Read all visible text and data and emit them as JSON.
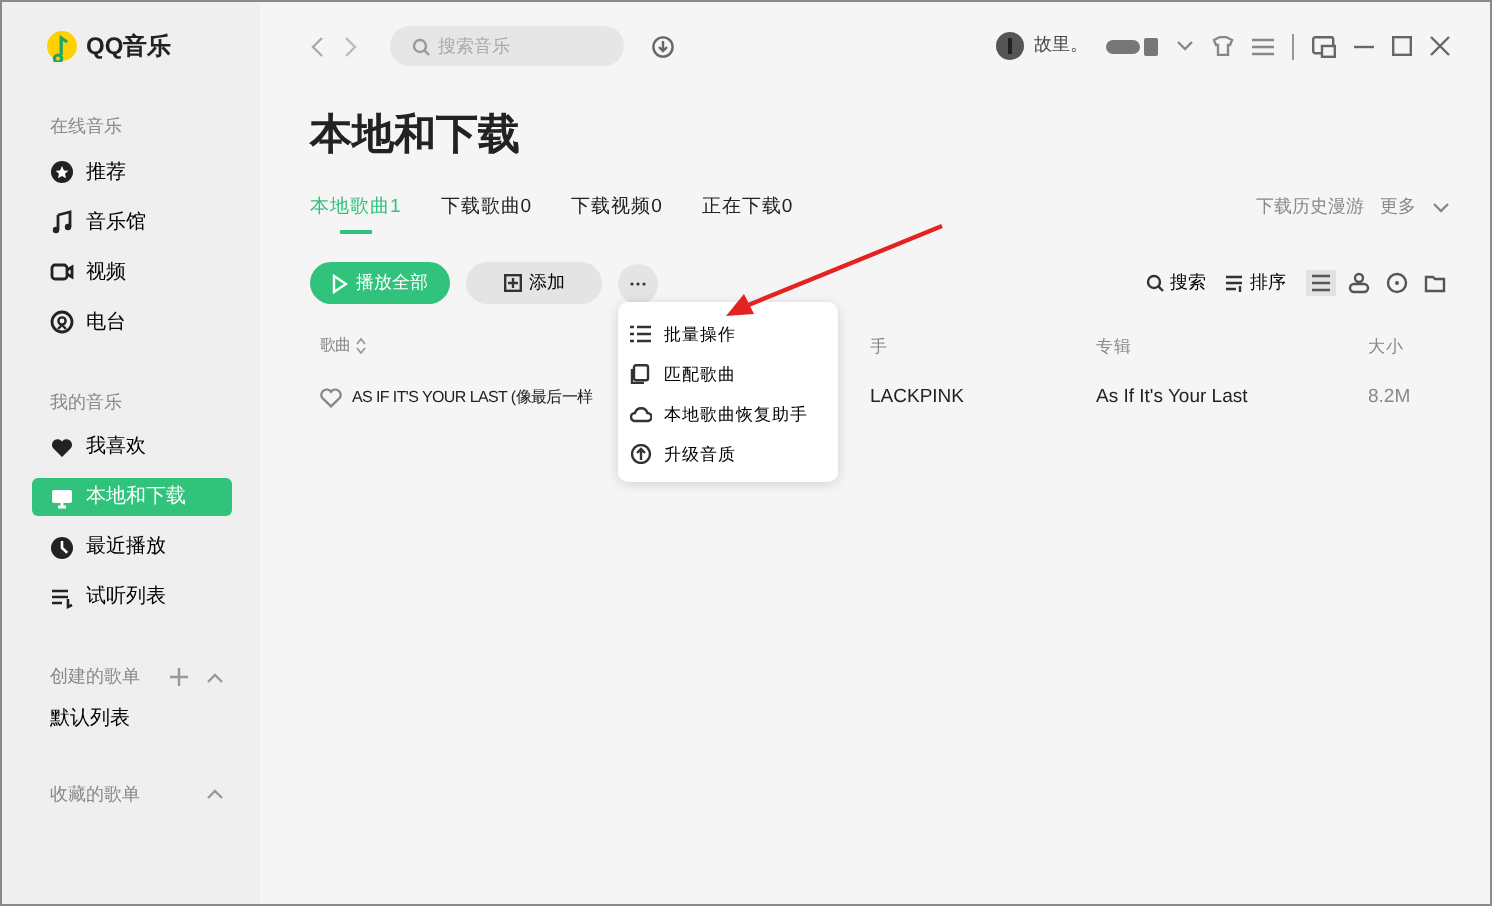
{
  "app": {
    "name": "QQ音乐"
  },
  "sidebar": {
    "sections": [
      {
        "title": "在线音乐",
        "items": [
          {
            "label": "推荐",
            "selected": false
          },
          {
            "label": "音乐馆",
            "selected": false
          },
          {
            "label": "视频",
            "selected": false
          },
          {
            "label": "电台",
            "selected": false
          }
        ]
      },
      {
        "title": "我的音乐",
        "items": [
          {
            "label": "我喜欢",
            "selected": false
          },
          {
            "label": "本地和下载",
            "selected": true
          },
          {
            "label": "最近播放",
            "selected": false
          },
          {
            "label": "试听列表",
            "selected": false
          }
        ]
      },
      {
        "title": "创建的歌单",
        "expanded": true,
        "can_add": true,
        "playlists": [
          "默认列表"
        ]
      },
      {
        "title": "收藏的歌单",
        "expanded": true,
        "can_add": false
      }
    ]
  },
  "topbar": {
    "search": {
      "placeholder": "搜索音乐"
    },
    "user": {
      "name": "故里。"
    }
  },
  "page": {
    "title": "本地和下载",
    "tabs": [
      {
        "label": "本地歌曲1",
        "selected": true
      },
      {
        "label": "下载歌曲0",
        "selected": false
      },
      {
        "label": "下载视频0",
        "selected": false
      },
      {
        "label": "正在下载0",
        "selected": false
      }
    ],
    "links": [
      "下载历史漫游",
      "更多"
    ],
    "actions": {
      "play_all": "播放全部",
      "add": "添加"
    },
    "tools": [
      "搜索",
      "排序"
    ],
    "view_modes": [
      {
        "selected": true
      },
      {
        "selected": false
      },
      {
        "selected": false
      },
      {
        "selected": false
      }
    ],
    "table": {
      "columns": [
        "歌曲",
        "手",
        "专辑",
        "大小"
      ],
      "rows": [
        {
          "liked": false,
          "title": "AS IF IT'S YOUR LAST (像最后一样",
          "artist": "LACKPINK",
          "album": "As If It's Your Last",
          "size": "8.2M"
        }
      ]
    },
    "menu": {
      "items": [
        "批量操作",
        "匹配歌曲",
        "本地歌曲恢复助手",
        "升级音质"
      ]
    }
  }
}
